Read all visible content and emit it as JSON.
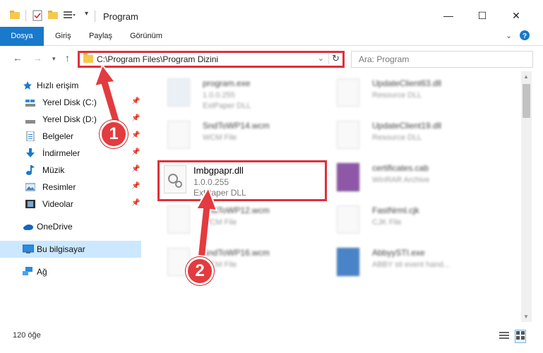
{
  "window": {
    "title": "Program"
  },
  "ribbon": {
    "tabs": [
      "Dosya",
      "Giriş",
      "Paylaş",
      "Görünüm"
    ]
  },
  "address": {
    "path": "C:\\Program Files\\Program Dizini",
    "search_placeholder": "Ara: Program"
  },
  "sidebar": {
    "items": [
      {
        "label": "Hızlı erişim"
      },
      {
        "label": "Yerel Disk (C:)"
      },
      {
        "label": "Yerel Disk (D:)"
      },
      {
        "label": "Belgeler"
      },
      {
        "label": "İndirmeler"
      },
      {
        "label": "Müzik"
      },
      {
        "label": "Resimler"
      },
      {
        "label": "Videolar"
      },
      {
        "label": "OneDrive"
      },
      {
        "label": "Bu bilgisayar"
      },
      {
        "label": "Ağ"
      }
    ]
  },
  "files": [
    {
      "name": "program.exe",
      "line1": "1.0.0.255",
      "line2": "ExtPaper DLL"
    },
    {
      "name": "UpdateClient63.dll",
      "line1": "Resource DLL",
      "line2": ""
    },
    {
      "name": "SndToWP14.wcm",
      "line1": "WCM File",
      "line2": ""
    },
    {
      "name": "UpdateClient19.dll",
      "line1": "Resource DLL",
      "line2": ""
    },
    {
      "name": "Imbgpapr.dll",
      "line1": "1.0.0.255",
      "line2": "ExtPaper DLL"
    },
    {
      "name": "certificates.cab",
      "line1": "WinRAR Archive",
      "line2": ""
    },
    {
      "name": "SndToWP12.wcm",
      "line1": "WCM File",
      "line2": ""
    },
    {
      "name": "FastNrml.cjk",
      "line1": "CJK File",
      "line2": ""
    },
    {
      "name": "SndToWP16.wcm",
      "line1": "WCM File",
      "line2": ""
    },
    {
      "name": "AbbyySTI.exe",
      "line1": "ABBY sti event hand...",
      "line2": ""
    }
  ],
  "status": {
    "count": "120 öğe"
  },
  "callouts": {
    "one": "1",
    "two": "2"
  },
  "colors": {
    "accent": "#1979ca",
    "highlight": "#e0303a",
    "selected": "#cce8ff"
  }
}
